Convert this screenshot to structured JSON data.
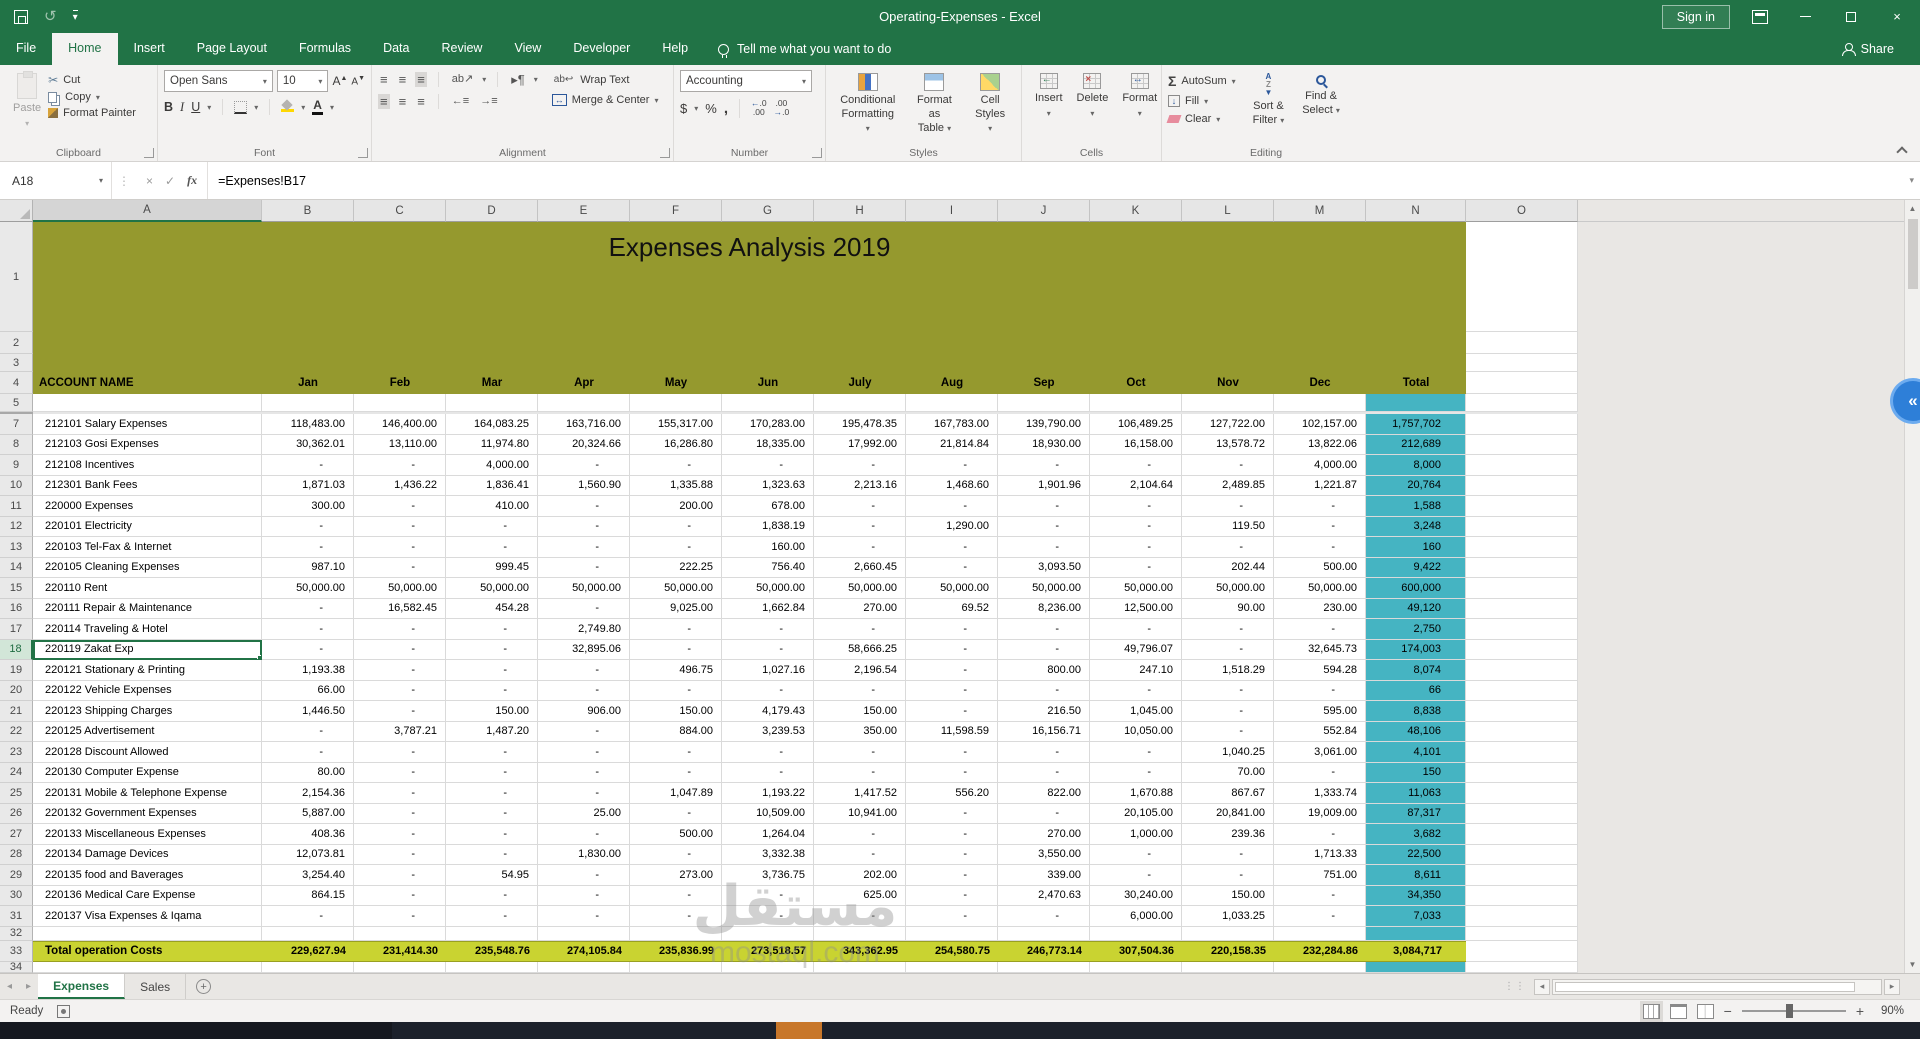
{
  "title_bar": {
    "title": "Operating-Expenses  -  Excel",
    "sign_in": "Sign in"
  },
  "ribbon_tabs": [
    "File",
    "Home",
    "Insert",
    "Page Layout",
    "Formulas",
    "Data",
    "Review",
    "View",
    "Developer",
    "Help"
  ],
  "tell_me": "Tell me what you want to do",
  "share": "Share",
  "ribbon": {
    "clipboard": {
      "label": "Clipboard",
      "paste": "Paste",
      "cut": "Cut",
      "copy": "Copy",
      "format_painter": "Format Painter"
    },
    "font": {
      "label": "Font",
      "name": "Open Sans",
      "size": "10",
      "bold": "B",
      "italic": "I",
      "underline": "U"
    },
    "alignment": {
      "label": "Alignment",
      "wrap": "Wrap Text",
      "merge": "Merge & Center"
    },
    "number": {
      "label": "Number",
      "format": "Accounting",
      "currency": "$",
      "percent": "%",
      "comma": ","
    },
    "styles": {
      "label": "Styles",
      "conditional_1": "Conditional",
      "conditional_2": "Formatting",
      "table_1": "Format as",
      "table_2": "Table",
      "cellstyles_1": "Cell",
      "cellstyles_2": "Styles"
    },
    "cells": {
      "label": "Cells",
      "insert": "Insert",
      "delete": "Delete",
      "format": "Format"
    },
    "editing": {
      "label": "Editing",
      "autosum": "AutoSum",
      "fill": "Fill",
      "clear": "Clear",
      "sort_1": "Sort &",
      "sort_2": "Filter",
      "find_1": "Find &",
      "find_2": "Select"
    }
  },
  "formula_bar": {
    "name_box": "A18",
    "formula": "=Expenses!B17"
  },
  "sheet": {
    "title": "Expenses Analysis 2019",
    "col_letters": [
      "A",
      "B",
      "C",
      "D",
      "E",
      "F",
      "G",
      "H",
      "I",
      "J",
      "K",
      "L",
      "M",
      "N",
      "O"
    ],
    "account_header": "ACCOUNT NAME",
    "months": [
      "Jan",
      "Feb",
      "Mar",
      "Apr",
      "May",
      "Jun",
      "July",
      "Aug",
      "Sep",
      "Oct",
      "Nov",
      "Dec"
    ],
    "total_header": "Total",
    "rows": [
      {
        "n": 7,
        "name": "212101 Salary Expenses",
        "vals": [
          "118,483.00",
          "146,400.00",
          "164,083.25",
          "163,716.00",
          "155,317.00",
          "170,283.00",
          "195,478.35",
          "167,783.00",
          "139,790.00",
          "106,489.25",
          "127,722.00",
          "102,157.00",
          "1,757,702"
        ]
      },
      {
        "n": 8,
        "name": "212103 Gosi Expenses",
        "vals": [
          "30,362.01",
          "13,110.00",
          "11,974.80",
          "20,324.66",
          "16,286.80",
          "18,335.00",
          "17,992.00",
          "21,814.84",
          "18,930.00",
          "16,158.00",
          "13,578.72",
          "13,822.06",
          "212,689"
        ]
      },
      {
        "n": 9,
        "name": "212108 Incentives",
        "vals": [
          "-",
          "-",
          "4,000.00",
          "-",
          "-",
          "-",
          "-",
          "-",
          "-",
          "-",
          "-",
          "4,000.00",
          "8,000"
        ]
      },
      {
        "n": 10,
        "name": "212301 Bank Fees",
        "vals": [
          "1,871.03",
          "1,436.22",
          "1,836.41",
          "1,560.90",
          "1,335.88",
          "1,323.63",
          "2,213.16",
          "1,468.60",
          "1,901.96",
          "2,104.64",
          "2,489.85",
          "1,221.87",
          "20,764"
        ]
      },
      {
        "n": 11,
        "name": "220000 Expenses",
        "vals": [
          "300.00",
          "-",
          "410.00",
          "-",
          "200.00",
          "678.00",
          "-",
          "-",
          "-",
          "-",
          "-",
          "-",
          "1,588"
        ]
      },
      {
        "n": 12,
        "name": "220101 Electricity",
        "vals": [
          "-",
          "-",
          "-",
          "-",
          "-",
          "1,838.19",
          "-",
          "1,290.00",
          "-",
          "-",
          "119.50",
          "-",
          "3,248"
        ]
      },
      {
        "n": 13,
        "name": "220103 Tel-Fax & Internet",
        "vals": [
          "-",
          "-",
          "-",
          "-",
          "-",
          "160.00",
          "-",
          "-",
          "-",
          "-",
          "-",
          "-",
          "160"
        ]
      },
      {
        "n": 14,
        "name": "220105 Cleaning Expenses",
        "vals": [
          "987.10",
          "-",
          "999.45",
          "-",
          "222.25",
          "756.40",
          "2,660.45",
          "-",
          "3,093.50",
          "-",
          "202.44",
          "500.00",
          "9,422"
        ]
      },
      {
        "n": 15,
        "name": "220110 Rent",
        "vals": [
          "50,000.00",
          "50,000.00",
          "50,000.00",
          "50,000.00",
          "50,000.00",
          "50,000.00",
          "50,000.00",
          "50,000.00",
          "50,000.00",
          "50,000.00",
          "50,000.00",
          "50,000.00",
          "600,000"
        ]
      },
      {
        "n": 16,
        "name": "220111 Repair & Maintenance",
        "vals": [
          "-",
          "16,582.45",
          "454.28",
          "-",
          "9,025.00",
          "1,662.84",
          "270.00",
          "69.52",
          "8,236.00",
          "12,500.00",
          "90.00",
          "230.00",
          "49,120"
        ]
      },
      {
        "n": 17,
        "name": "220114 Traveling & Hotel",
        "vals": [
          "-",
          "-",
          "-",
          "2,749.80",
          "-",
          "-",
          "-",
          "-",
          "-",
          "-",
          "-",
          "-",
          "2,750"
        ]
      },
      {
        "n": 18,
        "name": "220119 Zakat Exp",
        "vals": [
          "-",
          "-",
          "-",
          "32,895.06",
          "-",
          "-",
          "58,666.25",
          "-",
          "-",
          "49,796.07",
          "-",
          "32,645.73",
          "174,003"
        ]
      },
      {
        "n": 19,
        "name": "220121 Stationary & Printing",
        "vals": [
          "1,193.38",
          "-",
          "-",
          "-",
          "496.75",
          "1,027.16",
          "2,196.54",
          "-",
          "800.00",
          "247.10",
          "1,518.29",
          "594.28",
          "8,074"
        ]
      },
      {
        "n": 20,
        "name": "220122 Vehicle Expenses",
        "vals": [
          "66.00",
          "-",
          "-",
          "-",
          "-",
          "-",
          "-",
          "-",
          "-",
          "-",
          "-",
          "-",
          "66"
        ]
      },
      {
        "n": 21,
        "name": "220123 Shipping Charges",
        "vals": [
          "1,446.50",
          "-",
          "150.00",
          "906.00",
          "150.00",
          "4,179.43",
          "150.00",
          "-",
          "216.50",
          "1,045.00",
          "-",
          "595.00",
          "8,838"
        ]
      },
      {
        "n": 22,
        "name": "220125 Advertisement",
        "vals": [
          "-",
          "3,787.21",
          "1,487.20",
          "-",
          "884.00",
          "3,239.53",
          "350.00",
          "11,598.59",
          "16,156.71",
          "10,050.00",
          "-",
          "552.84",
          "48,106"
        ]
      },
      {
        "n": 23,
        "name": "220128 Discount Allowed",
        "vals": [
          "-",
          "-",
          "-",
          "-",
          "-",
          "-",
          "-",
          "-",
          "-",
          "-",
          "1,040.25",
          "3,061.00",
          "4,101"
        ]
      },
      {
        "n": 24,
        "name": "220130 Computer Expense",
        "vals": [
          "80.00",
          "-",
          "-",
          "-",
          "-",
          "-",
          "-",
          "-",
          "-",
          "-",
          "70.00",
          "-",
          "150"
        ]
      },
      {
        "n": 25,
        "name": "220131 Mobile & Telephone Expense",
        "vals": [
          "2,154.36",
          "-",
          "-",
          "-",
          "1,047.89",
          "1,193.22",
          "1,417.52",
          "556.20",
          "822.00",
          "1,670.88",
          "867.67",
          "1,333.74",
          "11,063"
        ]
      },
      {
        "n": 26,
        "name": "220132 Government Expenses",
        "vals": [
          "5,887.00",
          "-",
          "-",
          "25.00",
          "-",
          "10,509.00",
          "10,941.00",
          "-",
          "-",
          "20,105.00",
          "20,841.00",
          "19,009.00",
          "87,317"
        ]
      },
      {
        "n": 27,
        "name": "220133 Miscellaneous Expenses",
        "vals": [
          "408.36",
          "-",
          "-",
          "-",
          "500.00",
          "1,264.04",
          "-",
          "-",
          "270.00",
          "1,000.00",
          "239.36",
          "-",
          "3,682"
        ]
      },
      {
        "n": 28,
        "name": "220134 Damage Devices",
        "vals": [
          "12,073.81",
          "-",
          "-",
          "1,830.00",
          "-",
          "3,332.38",
          "-",
          "-",
          "3,550.00",
          "-",
          "-",
          "1,713.33",
          "22,500"
        ]
      },
      {
        "n": 29,
        "name": "220135 food and Baverages",
        "vals": [
          "3,254.40",
          "-",
          "54.95",
          "-",
          "273.00",
          "3,736.75",
          "202.00",
          "-",
          "339.00",
          "-",
          "-",
          "751.00",
          "8,611"
        ]
      },
      {
        "n": 30,
        "name": "220136 Medical Care Expense",
        "vals": [
          "864.15",
          "-",
          "-",
          "-",
          "-",
          "-",
          "625.00",
          "-",
          "2,470.63",
          "30,240.00",
          "150.00",
          "-",
          "34,350"
        ]
      },
      {
        "n": 31,
        "name": "220137 Visa Expenses & Iqama",
        "vals": [
          "-",
          "-",
          "-",
          "-",
          "-",
          "-",
          "-",
          "-",
          "-",
          "6,000.00",
          "1,033.25",
          "-",
          "7,033"
        ]
      }
    ],
    "total_row": {
      "n": 33,
      "name": "Total operation  Costs",
      "vals": [
        "229,627.94",
        "231,414.30",
        "235,548.76",
        "274,105.84",
        "235,836.99",
        "273,518.57",
        "343,362.95",
        "254,580.75",
        "246,773.14",
        "307,504.36",
        "220,158.35",
        "232,284.86",
        "3,084,717"
      ]
    },
    "selected_cell": "A18"
  },
  "sheet_tabs": [
    "Expenses",
    "Sales"
  ],
  "status": {
    "ready": "Ready",
    "zoom": "90%"
  },
  "watermark": {
    "ar": "مستقل",
    "en": "mostaql.com"
  },
  "colors": {
    "excel_green": "#217346",
    "olive_banner": "#95992e",
    "teal_total": "#45b4c2",
    "lime_total_row": "#c9d331"
  }
}
